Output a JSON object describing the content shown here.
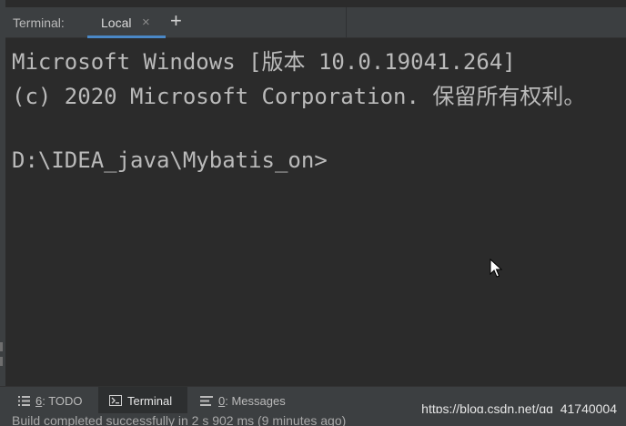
{
  "header": {
    "title": "Terminal:",
    "tab_label": "Local",
    "tab_close": "×",
    "add_label": "+"
  },
  "terminal": {
    "lines": [
      "Microsoft Windows [版本 10.0.19041.264]",
      "(c) 2020 Microsoft Corporation. 保留所有权利。",
      "",
      "D:\\IDEA_java\\Mybatis_on>"
    ]
  },
  "tool_tabs": [
    {
      "mnemonic": "6",
      "label": ": TODO",
      "icon": "list-icon"
    },
    {
      "label": "Terminal",
      "icon": "terminal-icon"
    },
    {
      "mnemonic": "0",
      "label": ": Messages",
      "icon": "messages-icon"
    }
  ],
  "watermark": "https://blog.csdn.net/qq_41740004",
  "status": "Build completed successfully in 2 s 902 ms (9 minutes ago)",
  "colors": {
    "terminal_bg": "#2b2b2b",
    "panel_bg": "#3c3f41",
    "terminal_text": "#bababa",
    "accent": "#4a88c7"
  }
}
